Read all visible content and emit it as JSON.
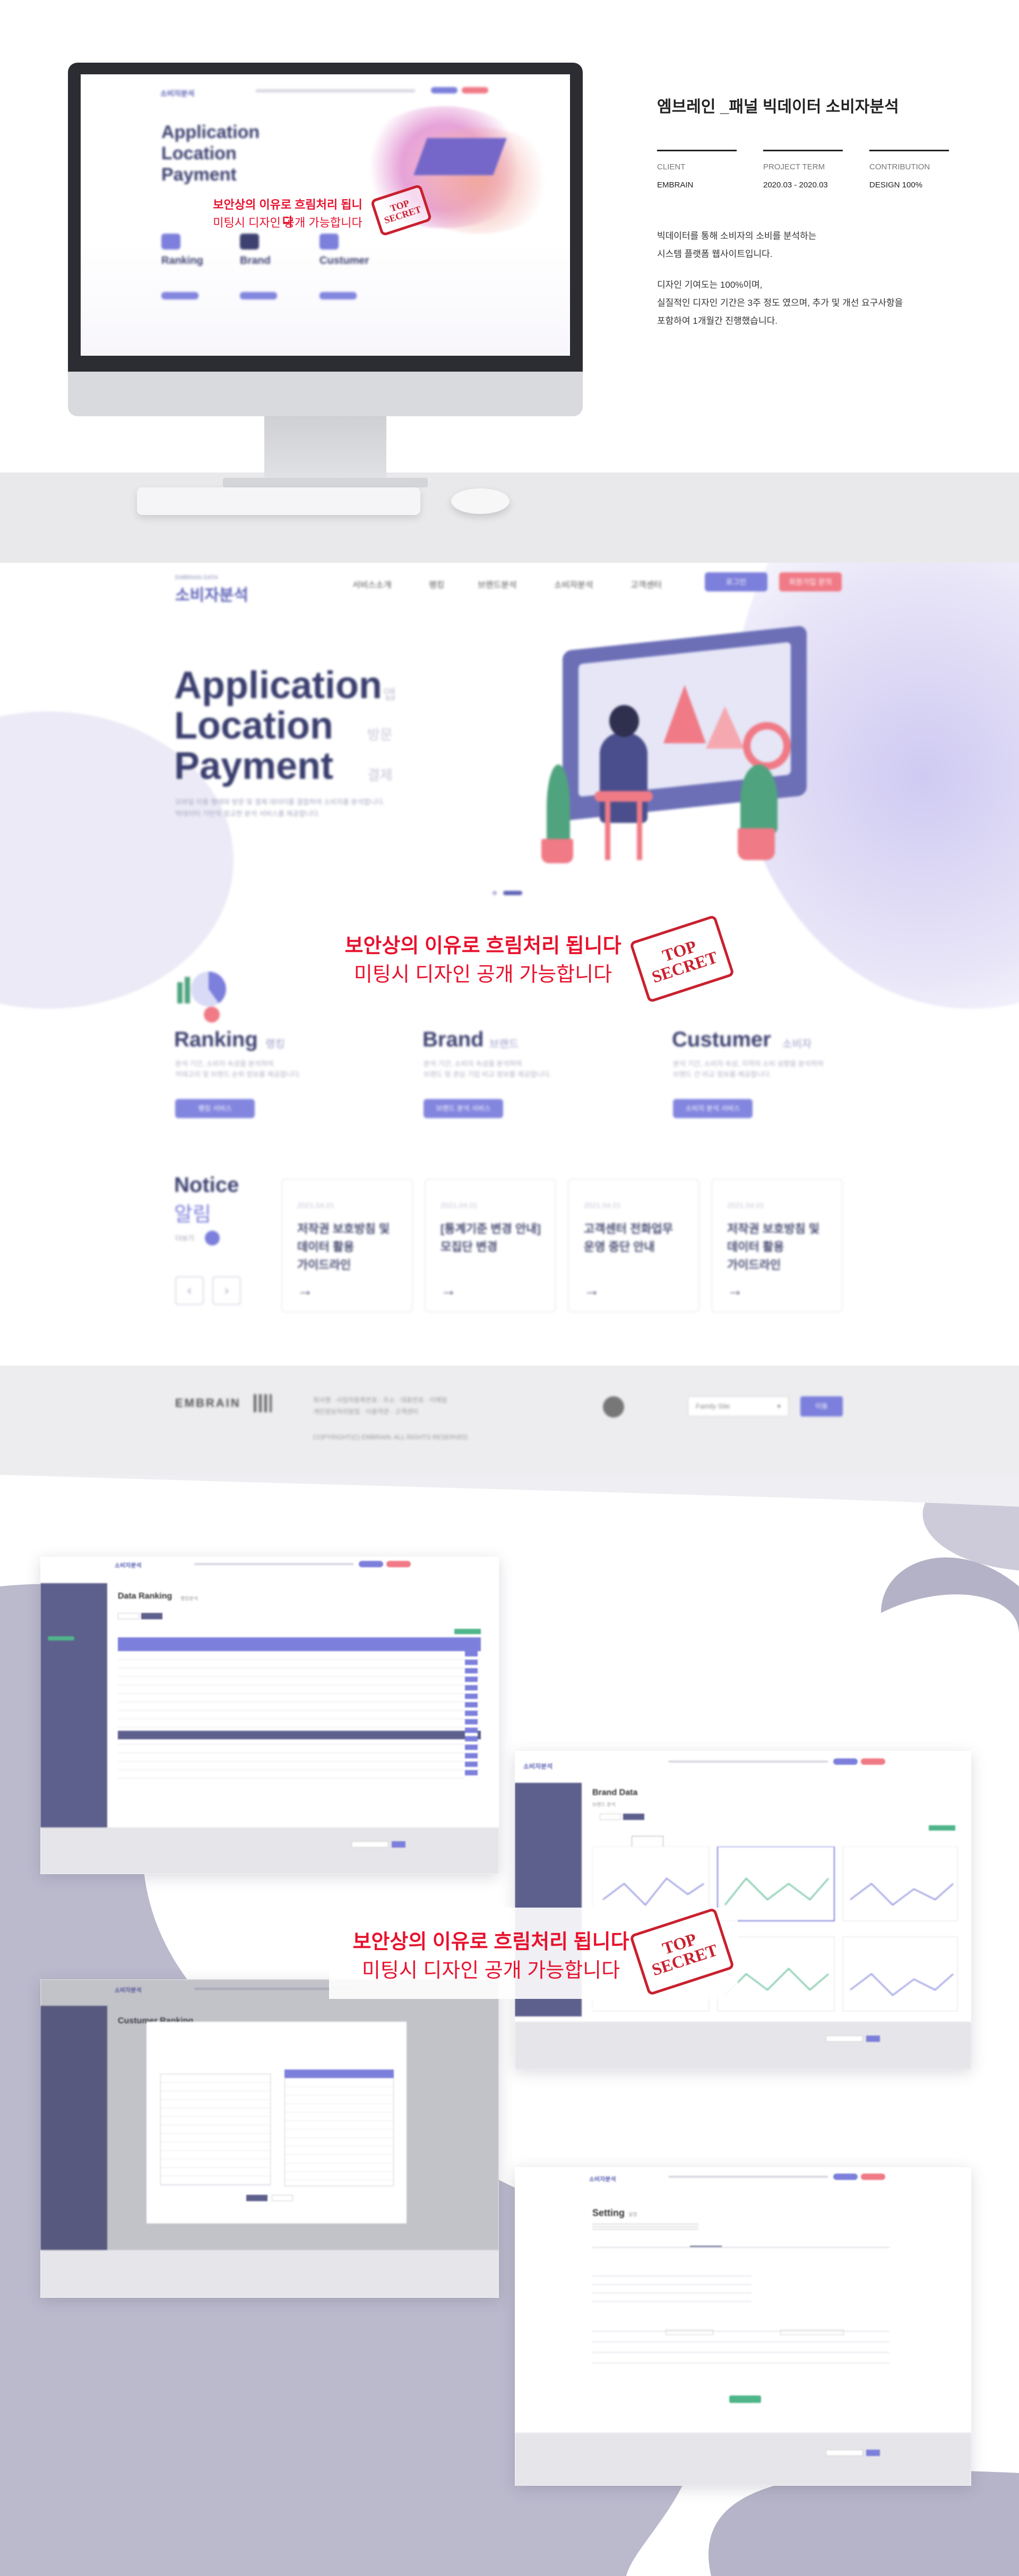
{
  "project": {
    "title": "엠브레인 _패널 빅데이터 소비자분석",
    "meta": [
      {
        "label": "CLIENT",
        "value": "EMBRAIN"
      },
      {
        "label": "PROJECT TERM",
        "value": "2020.03 - 2020.03"
      },
      {
        "label": "CONTRIBUTION",
        "value": "DESIGN 100%"
      }
    ],
    "description": [
      "빅데이터를 통해 소비자의 소비를 분석하는",
      "시스템 플랫폼 웹사이트입니다.",
      "디자인 기여도는 100%이며,",
      "실질적인 디자인 기간은 3주 정도 였으며, 추가 및 개선 요구사항을",
      "포함하여 1개월간 진행했습니다."
    ]
  },
  "watermark": {
    "line1": "보안상의 이유로 흐림처리 됩니다",
    "line2": "미팅시 디자인 공개 가능합니다",
    "stamp_top": "TOP",
    "stamp_bottom": "SECRET"
  },
  "site": {
    "logo_small": "EMBRAIN DATA",
    "logo": "소비자분석",
    "nav": [
      "서비스소개",
      "랭킹",
      "브랜드분석",
      "소비자분석",
      "고객센터"
    ],
    "login": "로그인",
    "join": "회원가입 문의",
    "hero": {
      "lines": [
        {
          "word": "Application",
          "sub": "앱"
        },
        {
          "word": "Location",
          "sub": "방문"
        },
        {
          "word": "Payment",
          "sub": "결제"
        }
      ],
      "desc1": "모바일 이용 행태와 방문 및 결제 데이터를 결합하여 소비자를 분석합니다.",
      "desc2": "빅데이터 기반의 정교한 분석 서비스를 제공합니다."
    },
    "features": [
      {
        "title": "Ranking",
        "sub": "랭킹",
        "desc1": "분석 기간, 소비자 속성을 분석하여",
        "desc2": "카테고리 및 브랜드 순위 정보를 제공합니다.",
        "btn": "랭킹 서비스"
      },
      {
        "title": "Brand",
        "sub": "브랜드",
        "desc1": "분석 기간, 소비자 속성을 분석하여",
        "desc2": "브랜드 및 관심 기업 비교 정보를 제공합니다.",
        "btn": "브랜드 분석 서비스"
      },
      {
        "title": "Custumer",
        "sub": "소비자",
        "desc1": "분석 기간, 소비자 속성, 지역의 소비 성향을 분석하여",
        "desc2": "브랜드 간 비교 정보를 제공합니다.",
        "btn": "소비자 분석 서비스"
      }
    ],
    "notice": {
      "title": "Notice",
      "subtitle": "알림",
      "more": "더보기",
      "cards": [
        {
          "date": "2021.04.01",
          "lines": [
            "저작권 보호방침 및",
            "데이터 활용",
            "가이드라인"
          ]
        },
        {
          "date": "2021.04.01",
          "lines": [
            "[통계기준 변경 안내]",
            "모집단 변경"
          ]
        },
        {
          "date": "2021.04.01",
          "lines": [
            "고객센터 전화업무",
            "운영 중단 안내"
          ]
        },
        {
          "date": "2021.04.01",
          "lines": [
            "저작권 보호방침 및",
            "데이터 활용",
            "가이드라인"
          ]
        }
      ]
    },
    "footer": {
      "brand": "EMBRAIN",
      "line1": "회사명 · 사업자등록번호 · 주소 · 대표번호 · 이메일",
      "line2": "개인정보처리방침 · 이용약관 · 고객센터",
      "copyright": "COPYRIGHT(C) EMBRAIN. ALL RIGHTS RESERVED.",
      "family": "Family Site",
      "go": "이동"
    }
  },
  "screens": {
    "data_ranking": {
      "title": "Data Ranking",
      "sub": "랭킹분석"
    },
    "brand_data": {
      "title": "Brand Data",
      "sub": "브랜드 분석"
    },
    "customer_ranking": {
      "title": "Custumer Ranking"
    },
    "setting": {
      "title": "Setting",
      "sub": "설정"
    }
  }
}
